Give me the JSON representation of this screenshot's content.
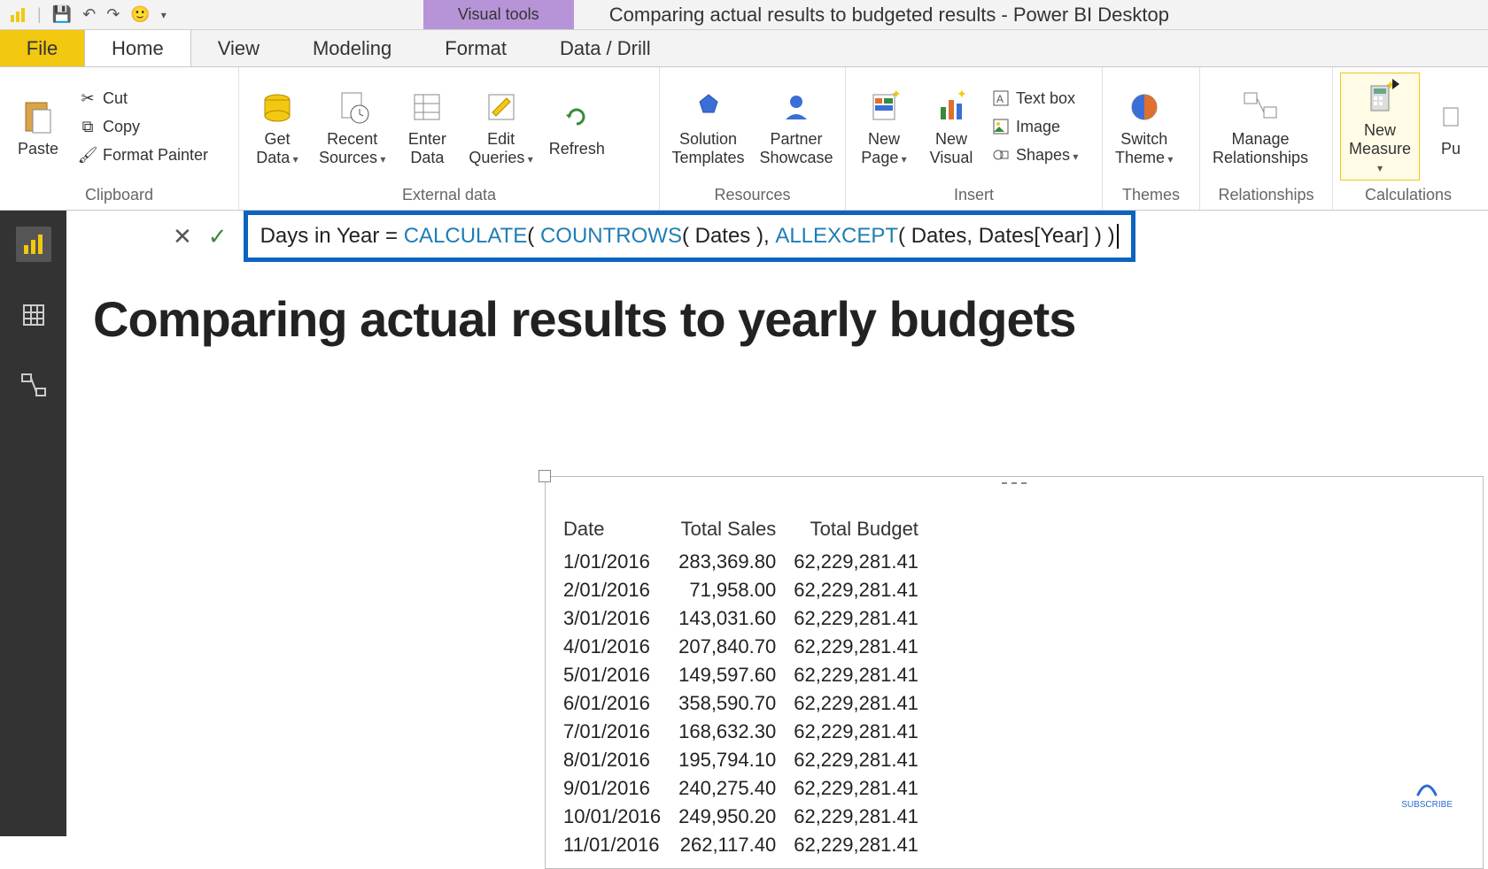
{
  "titlebar": {
    "visual_tools": "Visual tools",
    "window_title": "Comparing actual results to budgeted results - Power BI Desktop"
  },
  "tabs": {
    "file": "File",
    "home": "Home",
    "view": "View",
    "modeling": "Modeling",
    "format": "Format",
    "data_drill": "Data / Drill"
  },
  "ribbon": {
    "clipboard": {
      "label": "Clipboard",
      "paste": "Paste",
      "cut": "Cut",
      "copy": "Copy",
      "format_painter": "Format Painter"
    },
    "external": {
      "label": "External data",
      "get_data": "Get\nData",
      "recent_sources": "Recent\nSources",
      "enter_data": "Enter\nData",
      "edit_queries": "Edit\nQueries",
      "refresh": "Refresh"
    },
    "resources": {
      "label": "Resources",
      "solution_templates": "Solution\nTemplates",
      "partner_showcase": "Partner\nShowcase"
    },
    "insert": {
      "label": "Insert",
      "new_page": "New\nPage",
      "new_visual": "New\nVisual",
      "text_box": "Text box",
      "image": "Image",
      "shapes": "Shapes"
    },
    "themes": {
      "label": "Themes",
      "switch_theme": "Switch\nTheme"
    },
    "relationships": {
      "label": "Relationships",
      "manage": "Manage\nRelationships"
    },
    "calculations": {
      "label": "Calculations",
      "new_measure": "New\nMeasure",
      "pu": "Pu"
    }
  },
  "formula": {
    "prefix": "Days in Year = ",
    "fn_calculate": "CALCULATE",
    "mid1": "( ",
    "fn_countrows": "COUNTROWS",
    "mid2": "( Dates ), ",
    "fn_allexcept": "ALLEXCEPT",
    "mid3": "( Dates, Dates[Year] ) )"
  },
  "report": {
    "title": "Comparing actual results to yearly budgets",
    "table": {
      "headers": {
        "date": "Date",
        "sales": "Total Sales",
        "budget": "Total Budget"
      },
      "rows": [
        {
          "date": "1/01/2016",
          "sales": "283,369.80",
          "budget": "62,229,281.41"
        },
        {
          "date": "2/01/2016",
          "sales": "71,958.00",
          "budget": "62,229,281.41"
        },
        {
          "date": "3/01/2016",
          "sales": "143,031.60",
          "budget": "62,229,281.41"
        },
        {
          "date": "4/01/2016",
          "sales": "207,840.70",
          "budget": "62,229,281.41"
        },
        {
          "date": "5/01/2016",
          "sales": "149,597.60",
          "budget": "62,229,281.41"
        },
        {
          "date": "6/01/2016",
          "sales": "358,590.70",
          "budget": "62,229,281.41"
        },
        {
          "date": "7/01/2016",
          "sales": "168,632.30",
          "budget": "62,229,281.41"
        },
        {
          "date": "8/01/2016",
          "sales": "195,794.10",
          "budget": "62,229,281.41"
        },
        {
          "date": "9/01/2016",
          "sales": "240,275.40",
          "budget": "62,229,281.41"
        },
        {
          "date": "10/01/2016",
          "sales": "249,950.20",
          "budget": "62,229,281.41"
        },
        {
          "date": "11/01/2016",
          "sales": "262,117.40",
          "budget": "62,229,281.41"
        }
      ]
    }
  },
  "subscribe": "SUBSCRIBE"
}
